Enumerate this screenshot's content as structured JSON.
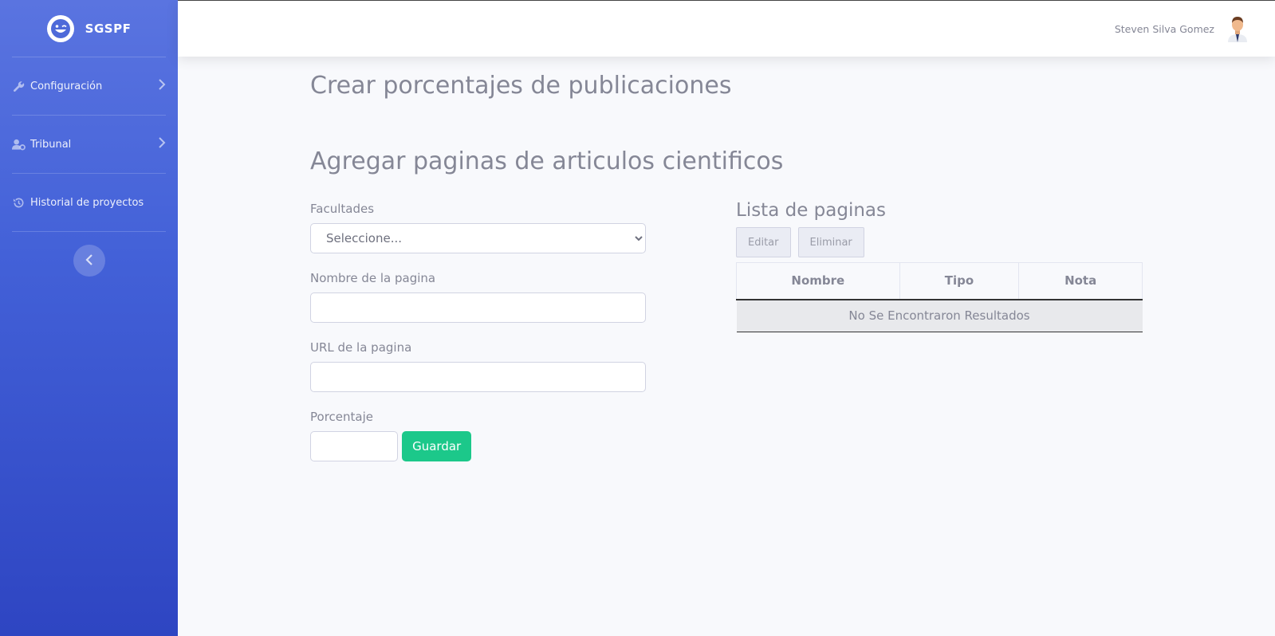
{
  "sidebar": {
    "brand": "SGSPF",
    "items": [
      {
        "label": "Configuración",
        "icon": "wrench-icon"
      },
      {
        "label": "Tribunal",
        "icon": "user-gear-icon"
      },
      {
        "label": "Historial de proyectos",
        "icon": "history-icon"
      }
    ]
  },
  "topbar": {
    "user_name": "Steven Silva Gomez"
  },
  "page": {
    "title": "Crear porcentajes de publicaciones",
    "section_title": "Agregar paginas de articulos cientificos"
  },
  "form": {
    "facultades_label": "Facultades",
    "facultades_selected": "Seleccione...",
    "nombre_label": "Nombre de la pagina",
    "nombre_value": "",
    "url_label": "URL de la pagina",
    "url_value": "",
    "porcentaje_label": "Porcentaje",
    "porcentaje_value": "",
    "save_label": "Guardar"
  },
  "list": {
    "title": "Lista de paginas",
    "edit_label": "Editar",
    "delete_label": "Eliminar",
    "columns": [
      "Nombre",
      "Tipo",
      "Nota"
    ],
    "empty_message": "No Se Encontraron Resultados"
  },
  "colors": {
    "sidebar_top": "#5a74e0",
    "sidebar_bottom": "#2e45c2",
    "success": "#1cc88a",
    "text_muted": "#858796"
  }
}
